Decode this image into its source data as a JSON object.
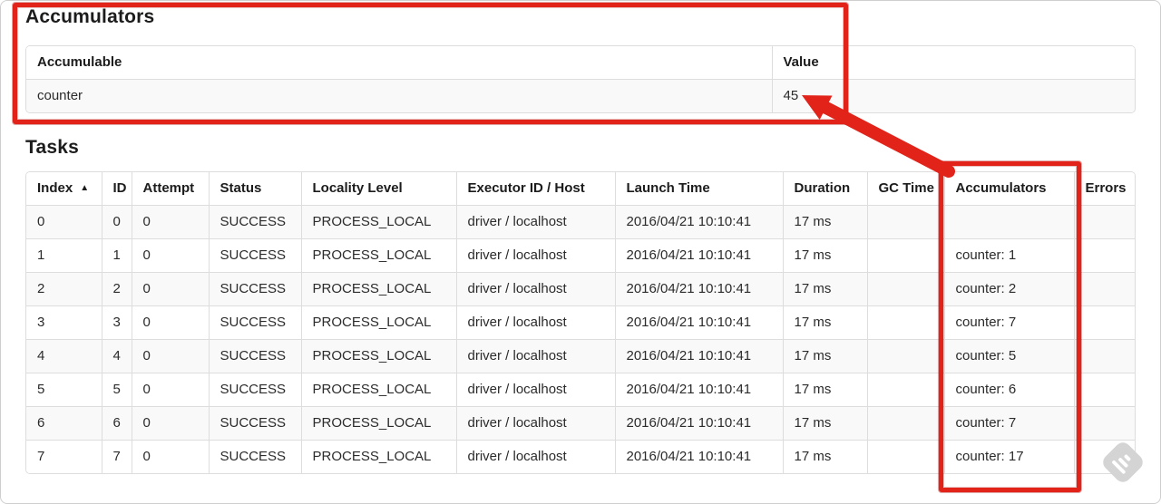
{
  "accumulators_section": {
    "title": "Accumulators",
    "table": {
      "headers": [
        "Accumulable",
        "Value"
      ],
      "rows": [
        [
          "counter",
          "45"
        ]
      ]
    }
  },
  "tasks_section": {
    "title": "Tasks",
    "table": {
      "headers": [
        "Index",
        "ID",
        "Attempt",
        "Status",
        "Locality Level",
        "Executor ID / Host",
        "Launch Time",
        "Duration",
        "GC Time",
        "Accumulators",
        "Errors"
      ],
      "sorted_column": "Index",
      "sort_indicator": "▲",
      "rows": [
        [
          "0",
          "0",
          "0",
          "SUCCESS",
          "PROCESS_LOCAL",
          "driver / localhost",
          "2016/04/21 10:10:41",
          "17 ms",
          "",
          "",
          ""
        ],
        [
          "1",
          "1",
          "0",
          "SUCCESS",
          "PROCESS_LOCAL",
          "driver / localhost",
          "2016/04/21 10:10:41",
          "17 ms",
          "",
          "counter: 1",
          ""
        ],
        [
          "2",
          "2",
          "0",
          "SUCCESS",
          "PROCESS_LOCAL",
          "driver / localhost",
          "2016/04/21 10:10:41",
          "17 ms",
          "",
          "counter: 2",
          ""
        ],
        [
          "3",
          "3",
          "0",
          "SUCCESS",
          "PROCESS_LOCAL",
          "driver / localhost",
          "2016/04/21 10:10:41",
          "17 ms",
          "",
          "counter: 7",
          ""
        ],
        [
          "4",
          "4",
          "0",
          "SUCCESS",
          "PROCESS_LOCAL",
          "driver / localhost",
          "2016/04/21 10:10:41",
          "17 ms",
          "",
          "counter: 5",
          ""
        ],
        [
          "5",
          "5",
          "0",
          "SUCCESS",
          "PROCESS_LOCAL",
          "driver / localhost",
          "2016/04/21 10:10:41",
          "17 ms",
          "",
          "counter: 6",
          ""
        ],
        [
          "6",
          "6",
          "0",
          "SUCCESS",
          "PROCESS_LOCAL",
          "driver / localhost",
          "2016/04/21 10:10:41",
          "17 ms",
          "",
          "counter: 7",
          ""
        ],
        [
          "7",
          "7",
          "0",
          "SUCCESS",
          "PROCESS_LOCAL",
          "driver / localhost",
          "2016/04/21 10:10:41",
          "17 ms",
          "",
          "counter: 17",
          ""
        ]
      ]
    }
  },
  "annotations": {
    "highlight_color": "#e2231a",
    "watermark_icon": "feedly-icon"
  }
}
